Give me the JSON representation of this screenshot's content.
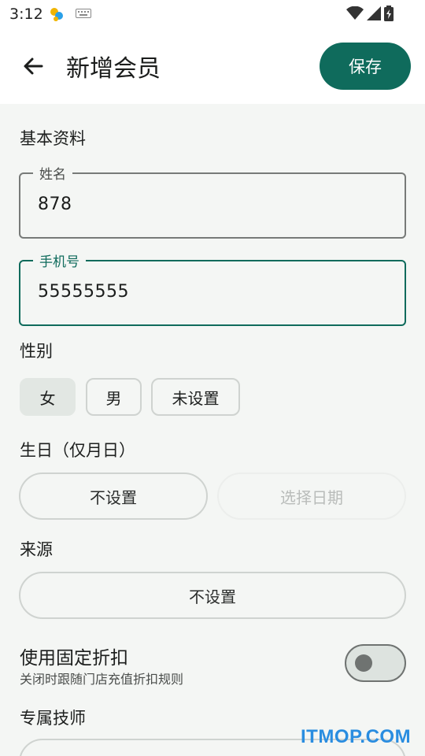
{
  "status_bar": {
    "time": "3:12",
    "icons": [
      "app-notification-icon",
      "keyboard-icon",
      "wifi-icon",
      "cell-signal-icon",
      "battery-charging-icon"
    ]
  },
  "app_bar": {
    "title": "新增会员",
    "back_icon": "arrow-back-icon",
    "save_label": "保存"
  },
  "basic_info": {
    "section_title": "基本资料",
    "name_field": {
      "label": "姓名",
      "value": "878"
    },
    "phone_field": {
      "label": "手机号",
      "value": "55555555"
    }
  },
  "gender": {
    "label": "性别",
    "options": [
      "女",
      "男",
      "未设置"
    ],
    "selected": "女"
  },
  "birthday": {
    "label": "生日（仅月日）",
    "not_set_label": "不设置",
    "pick_date_label": "选择日期"
  },
  "source": {
    "label": "来源",
    "value": "不设置"
  },
  "fixed_discount": {
    "title": "使用固定折扣",
    "subtitle": "关闭时跟随门店充值折扣规则",
    "enabled": false
  },
  "technician": {
    "label": "专属技师"
  },
  "watermark": "ITMOP.COM",
  "colors": {
    "primary": "#0f6b5c",
    "background": "#f4f6f4",
    "outline": "#777a78",
    "watermark": "#2a8de0"
  }
}
